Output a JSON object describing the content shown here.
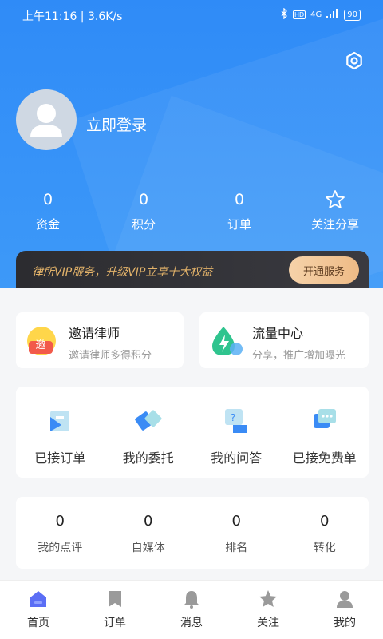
{
  "status_bar": {
    "time": "上午11:16 | 3.6K/s",
    "signal": "4G",
    "battery": "90"
  },
  "profile": {
    "login_text": "立即登录"
  },
  "stats": [
    {
      "value": "0",
      "label": "资金"
    },
    {
      "value": "0",
      "label": "积分"
    },
    {
      "value": "0",
      "label": "订单"
    },
    {
      "value": "",
      "label": "关注分享",
      "icon": "star-icon"
    }
  ],
  "vip": {
    "text": "律所VIP服务，升级VIP立享十大权益",
    "button": "开通服务"
  },
  "cards": {
    "invite": {
      "title": "邀请律师",
      "subtitle": "邀请律师多得积分",
      "badge": "邀"
    },
    "traffic": {
      "title": "流量中心",
      "subtitle": "分享，推广增加曝光"
    }
  },
  "services": [
    {
      "label": "已接订单",
      "icon": "received-order-icon"
    },
    {
      "label": "我的委托",
      "icon": "handshake-icon"
    },
    {
      "label": "我的问答",
      "icon": "qa-icon"
    },
    {
      "label": "已接免费单",
      "icon": "chat-icon"
    }
  ],
  "metrics": [
    {
      "value": "0",
      "label": "我的点评"
    },
    {
      "value": "0",
      "label": "自媒体"
    },
    {
      "value": "0",
      "label": "排名"
    },
    {
      "value": "0",
      "label": "转化"
    }
  ],
  "tabbar": [
    {
      "label": "首页",
      "icon": "home-icon"
    },
    {
      "label": "订单",
      "icon": "order-icon"
    },
    {
      "label": "消息",
      "icon": "bell-icon"
    },
    {
      "label": "关注",
      "icon": "star-icon"
    },
    {
      "label": "我的",
      "icon": "user-icon"
    }
  ],
  "colors": {
    "primary": "#2f8bf7",
    "vip_gold": "#e3b36a"
  }
}
